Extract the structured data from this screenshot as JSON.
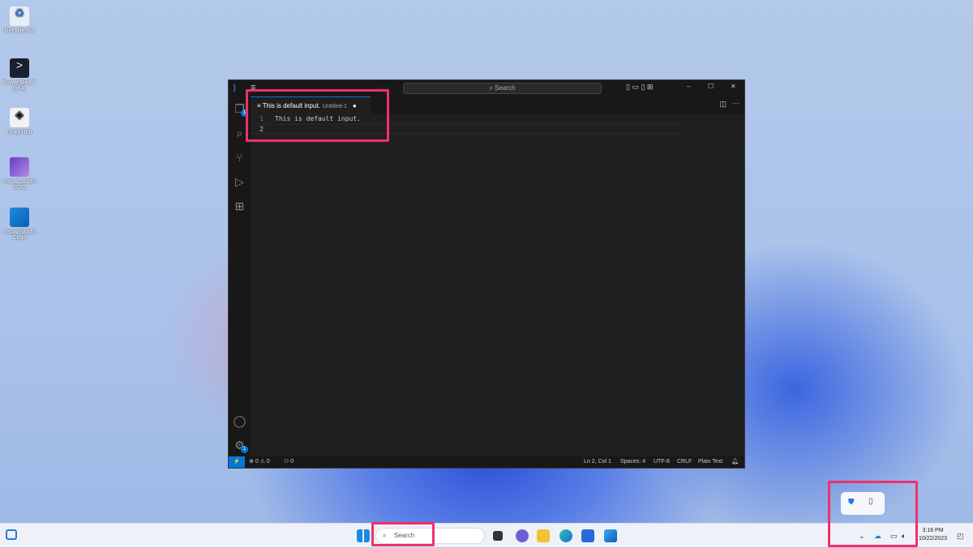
{
  "desktop": {
    "icons": [
      {
        "label": "Recycle Bin"
      },
      {
        "label": "PowerShell 7 (x64)"
      },
      {
        "label": "Unity Hub"
      },
      {
        "label": "Visual Studio 2022"
      },
      {
        "label": "Visual Studio Code"
      }
    ]
  },
  "vscode": {
    "search_placeholder": "Search",
    "tab": {
      "title": "This is default input.",
      "subtitle": "Untitled-1"
    },
    "lines": [
      {
        "n": "1",
        "text": "This is default input."
      },
      {
        "n": "2",
        "text": ""
      }
    ],
    "badges": {
      "explorer": "1",
      "settings": "1"
    },
    "status": {
      "errors": "0",
      "warnings": "0",
      "ports": "0",
      "position": "Ln 2, Col 1",
      "spaces": "Spaces: 4",
      "encoding": "UTF-8",
      "eol": "CRLF",
      "language": "Plain Text"
    }
  },
  "taskbar": {
    "search_placeholder": "Search",
    "time": "3:16 PM",
    "date": "10/22/2023"
  },
  "colors": {
    "highlight": "#f0306a",
    "accent": "#0078d4"
  }
}
